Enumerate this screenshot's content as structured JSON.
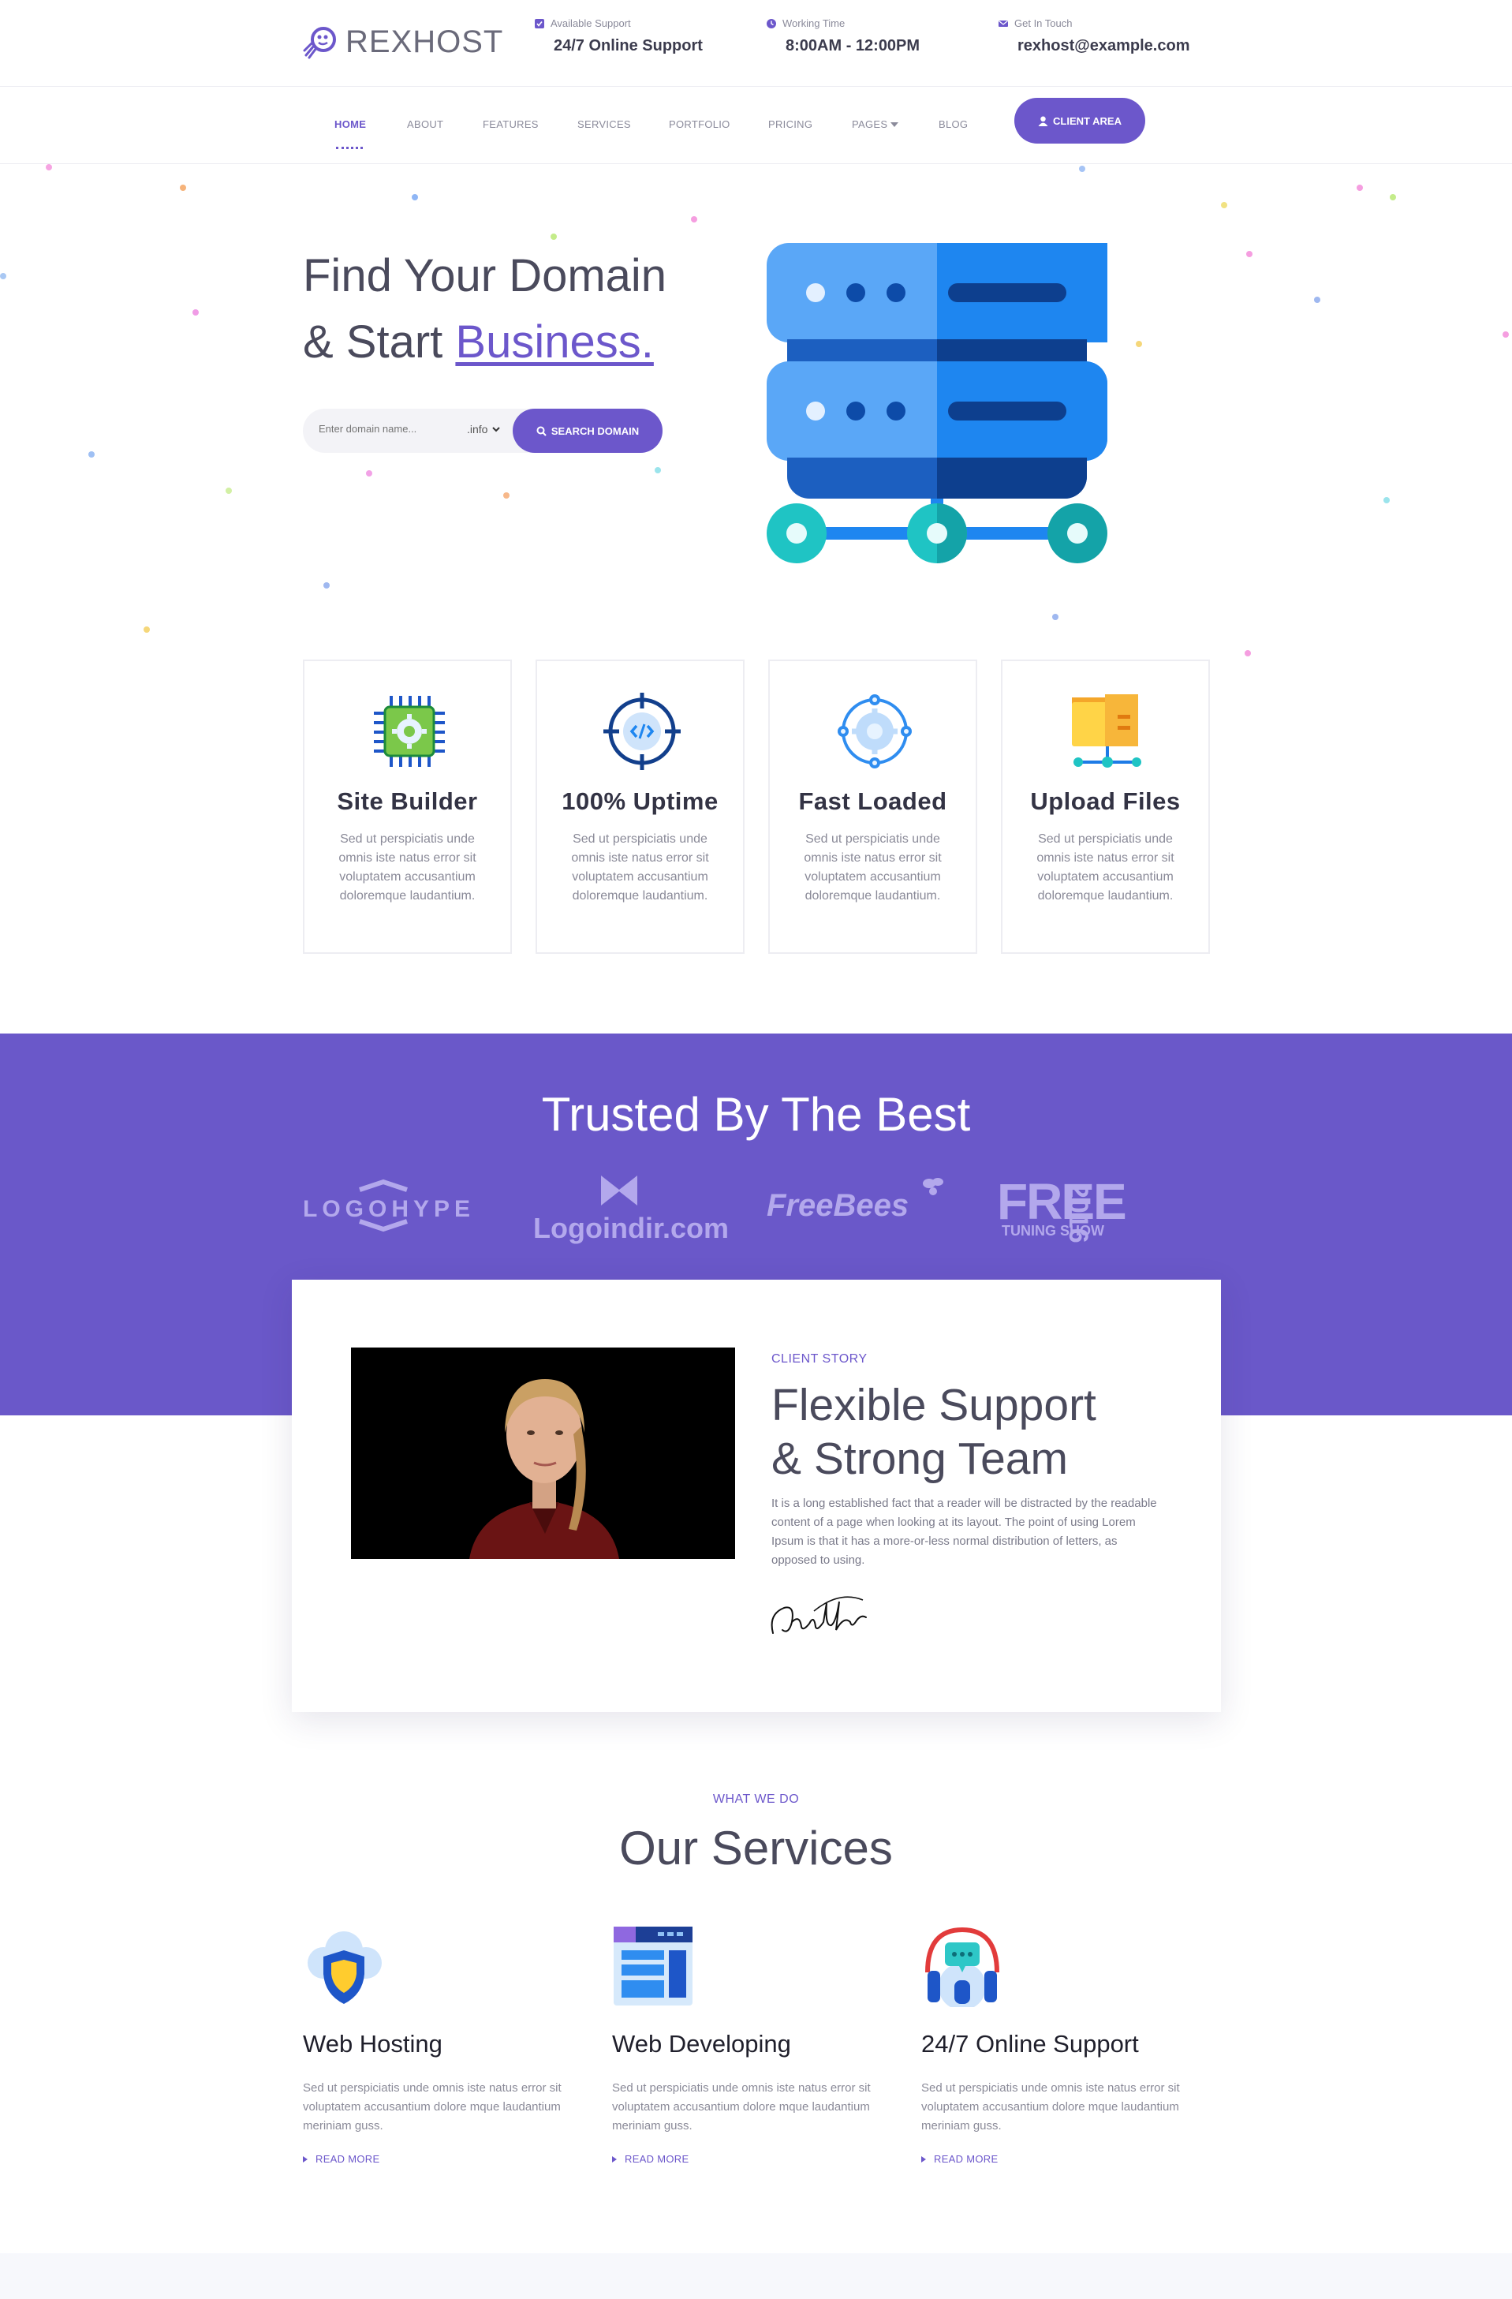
{
  "brand": {
    "name": "REXHOST"
  },
  "topbar": {
    "support_label": "Available Support",
    "support_value": "24/7 Online Support",
    "time_label": "Working Time",
    "time_value": "8:00AM - 12:00PM",
    "contact_label": "Get In Touch",
    "contact_value": "rexhost@example.com"
  },
  "nav": {
    "items": [
      "HOME",
      "ABOUT",
      "FEATURES",
      "SERVICES",
      "PORTFOLIO",
      "PRICING",
      "PAGES",
      "BLOG"
    ],
    "cta": "CLIENT AREA"
  },
  "hero": {
    "line1": "Find Your Domain",
    "line2_prefix": "& Start ",
    "line2_accent": "Business.",
    "search_placeholder": "Enter domain name...",
    "tld_selected": ".info",
    "search_button": "SEARCH DOMAIN"
  },
  "features": [
    {
      "title": "Site Builder",
      "text": "Sed ut perspiciatis unde omnis iste natus error sit voluptatem accusantium doloremque laudantium.",
      "icon": "chip-gear-icon"
    },
    {
      "title": "100% Uptime",
      "text": "Sed ut perspiciatis unde omnis iste natus error sit voluptatem accusantium doloremque laudantium.",
      "icon": "target-code-icon"
    },
    {
      "title": "Fast Loaded",
      "text": "Sed ut perspiciatis unde omnis iste natus error sit voluptatem accusantium doloremque laudantium.",
      "icon": "gear-network-icon"
    },
    {
      "title": "Upload Files",
      "text": "Sed ut perspiciatis unde omnis iste natus error sit voluptatem accusantium doloremque laudantium.",
      "icon": "folder-network-icon"
    }
  ],
  "trusted": {
    "title": "Trusted By The Best",
    "logos": [
      "LOGOHYPE",
      "Logoindir.com",
      "FreeBees",
      "FREE",
      "TUNING SHOW",
      "2016"
    ]
  },
  "story": {
    "eyebrow": "CLIENT STORY",
    "title_line1": "Flexible Support",
    "title_line2": "& Strong Team",
    "text": "It is a long established fact that a reader will be distracted by the readable content of a page when looking at its layout. The point of using Lorem Ipsum is that it has a more-or-less normal distribution of letters, as opposed to using.",
    "signature": "Arnold Palmer"
  },
  "services": {
    "eyebrow": "WHAT WE DO",
    "title": "Our Services",
    "items": [
      {
        "title": "Web Hosting",
        "text": "Sed ut perspiciatis unde omnis iste natus error sit voluptatem accusantium dolore mque laudantium meriniam guss.",
        "more": "READ MORE",
        "icon": "cloud-shield-icon"
      },
      {
        "title": "Web Developing",
        "text": "Sed ut perspiciatis unde omnis iste natus error sit voluptatem accusantium dolore mque laudantium meriniam guss.",
        "more": "READ MORE",
        "icon": "browser-layout-icon"
      },
      {
        "title": "24/7 Online Support",
        "text": "Sed ut perspiciatis unde omnis iste natus error sit voluptatem accusantium dolore mque laudantium meriniam guss.",
        "more": "READ MORE",
        "icon": "headset-chat-icon"
      }
    ]
  },
  "colors": {
    "accent": "#6c57cb",
    "trusted_bg": "#6a58c9",
    "text_dark": "#4a4a5c"
  }
}
